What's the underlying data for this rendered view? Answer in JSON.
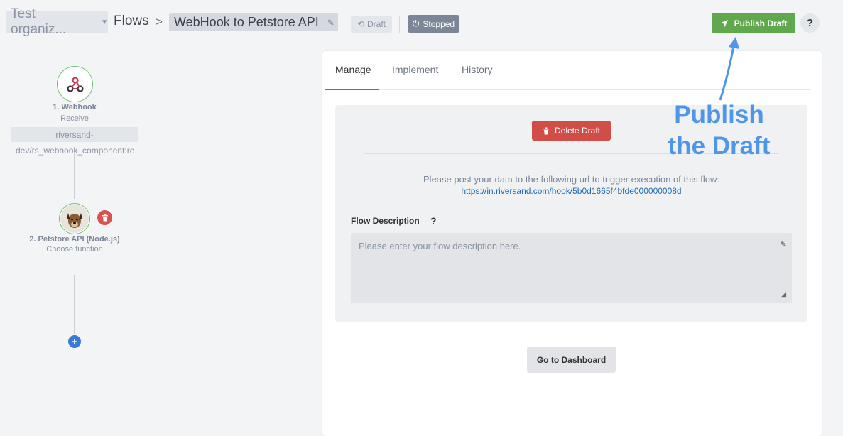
{
  "header": {
    "org_name": "Test organiz...",
    "breadcrumb_root": "Flows",
    "breadcrumb_sep": ">",
    "flow_name": "WebHook to Petstore API",
    "draft_badge": "Draft",
    "status_badge": "Stopped",
    "publish_label": "Publish Draft",
    "help_label": "?"
  },
  "flow_graph": {
    "nodes": [
      {
        "title": "1. Webhook",
        "subtitle": "Receive",
        "path_line1": "riversand-",
        "path_line2": "dev/rs_webhook_component:re"
      },
      {
        "title": "2. Petstore API (Node.js)",
        "subtitle": "Choose function"
      }
    ],
    "add_label": "+"
  },
  "panel": {
    "tabs": [
      {
        "label": "Manage",
        "active": true
      },
      {
        "label": "Implement",
        "active": false
      },
      {
        "label": "History",
        "active": false
      }
    ],
    "delete_draft_label": "Delete Draft",
    "post_text": "Please post your data to the following url to trigger execution of this flow:",
    "post_url": "https://in.riversand.com/hook/5b0d1665f4bfde000000008d",
    "description_label": "Flow Description",
    "description_help": "?",
    "description_placeholder": "Please enter your flow description here.",
    "dashboard_label": "Go to Dashboard"
  },
  "annotation": {
    "line1": "Publish",
    "line2": "the Draft",
    "color": "#4f95e8"
  },
  "colors": {
    "publish_green": "#5fa84e",
    "delete_red": "#d14d48",
    "accent_blue": "#3a7bd5",
    "stopped_gray": "#7c8696"
  }
}
